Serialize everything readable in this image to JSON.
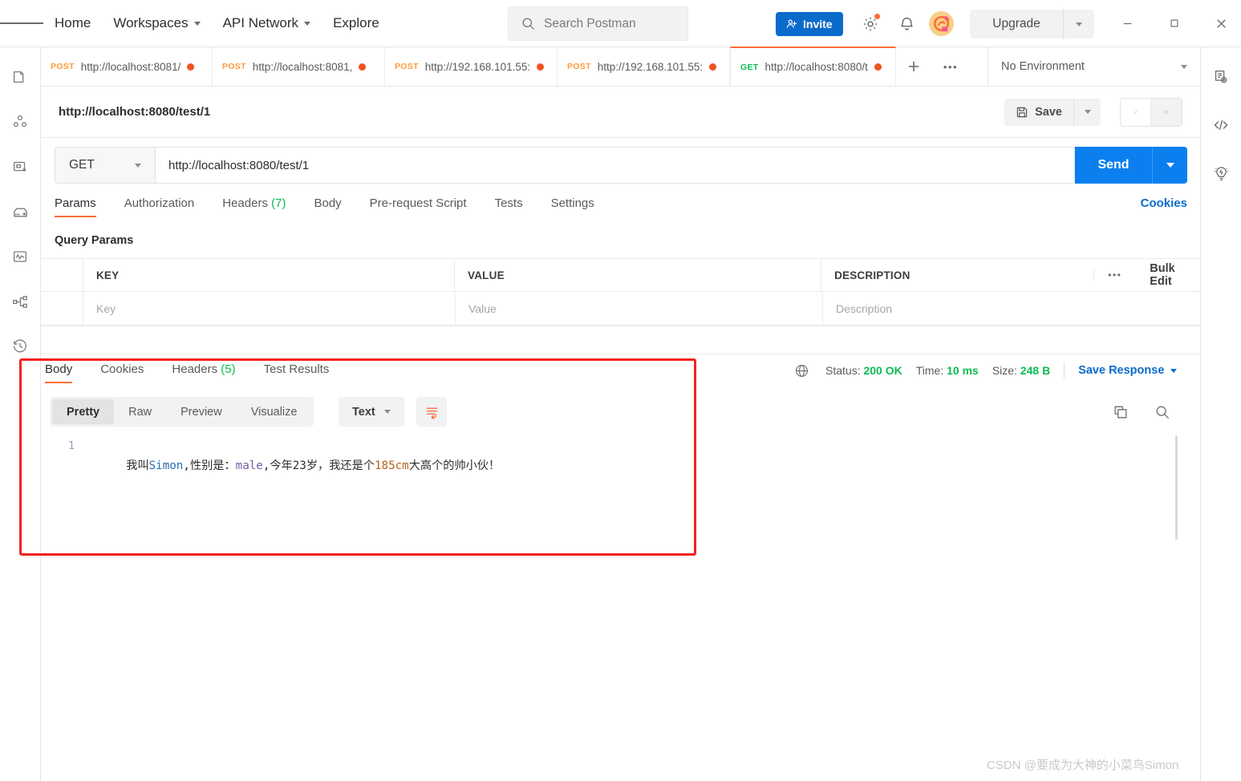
{
  "header": {
    "menu_icon": "hamburger-icon",
    "nav": [
      {
        "label": "Home",
        "has_caret": false
      },
      {
        "label": "Workspaces",
        "has_caret": true
      },
      {
        "label": "API Network",
        "has_caret": true
      },
      {
        "label": "Explore",
        "has_caret": false
      }
    ],
    "search_placeholder": "Search Postman",
    "invite_label": "Invite",
    "upgrade_label": "Upgrade",
    "icons": [
      "search-icon",
      "settings-gear-icon",
      "notifications-bell-icon",
      "user-avatar",
      "minimize-icon",
      "maximize-icon",
      "close-icon"
    ]
  },
  "left_rail": [
    {
      "name": "collections-icon"
    },
    {
      "name": "apis-icon"
    },
    {
      "name": "environments-icon"
    },
    {
      "name": "mock-servers-icon"
    },
    {
      "name": "monitors-icon"
    },
    {
      "name": "flows-icon"
    },
    {
      "name": "history-icon"
    }
  ],
  "right_rail": [
    {
      "name": "environment-quick-look-icon"
    },
    {
      "name": "code-snippet-icon"
    },
    {
      "name": "lightbulb-icon"
    }
  ],
  "tabs": [
    {
      "method": "POST",
      "url": "http://localhost:8081/",
      "unsaved": true,
      "active": false
    },
    {
      "method": "POST",
      "url": "http://localhost:8081,",
      "unsaved": true,
      "active": false
    },
    {
      "method": "POST",
      "url": "http://192.168.101.55:",
      "unsaved": true,
      "active": false
    },
    {
      "method": "POST",
      "url": "http://192.168.101.55:",
      "unsaved": true,
      "active": false
    },
    {
      "method": "GET",
      "url": "http://localhost:8080/t",
      "unsaved": true,
      "active": true
    }
  ],
  "tab_add_label": "+",
  "tab_more_label": "•••",
  "environment": {
    "selected": "No Environment"
  },
  "request": {
    "title": "http://localhost:8080/test/1",
    "save_label": "Save",
    "method": "GET",
    "url": "http://localhost:8080/test/1",
    "send_label": "Send",
    "tabs": [
      {
        "label": "Params",
        "count": "",
        "active": true
      },
      {
        "label": "Authorization",
        "count": "",
        "active": false
      },
      {
        "label": "Headers",
        "count": "(7)",
        "active": false
      },
      {
        "label": "Body",
        "count": "",
        "active": false
      },
      {
        "label": "Pre-request Script",
        "count": "",
        "active": false
      },
      {
        "label": "Tests",
        "count": "",
        "active": false
      },
      {
        "label": "Settings",
        "count": "",
        "active": false
      }
    ],
    "cookies_link": "Cookies",
    "query_params_label": "Query Params",
    "table": {
      "headers": [
        "KEY",
        "VALUE",
        "DESCRIPTION"
      ],
      "more_label": "•••",
      "bulk_edit_label": "Bulk Edit",
      "placeholder_row": [
        "Key",
        "Value",
        "Description"
      ]
    }
  },
  "response": {
    "tabs": [
      {
        "label": "Body",
        "count": "",
        "active": true
      },
      {
        "label": "Cookies",
        "count": "",
        "active": false
      },
      {
        "label": "Headers",
        "count": "(5)",
        "active": false
      },
      {
        "label": "Test Results",
        "count": "",
        "active": false
      }
    ],
    "view_modes": [
      {
        "label": "Pretty",
        "active": true
      },
      {
        "label": "Raw",
        "active": false
      },
      {
        "label": "Preview",
        "active": false
      },
      {
        "label": "Visualize",
        "active": false
      }
    ],
    "format": "Text",
    "wrap_icon": "word-wrap-icon",
    "line_number": "1",
    "body_segments": [
      {
        "text": "我叫",
        "color": "plain"
      },
      {
        "text": "Simon",
        "color": "blue"
      },
      {
        "text": ",性别是：",
        "color": "plain"
      },
      {
        "text": "male",
        "color": "purple"
      },
      {
        "text": ",今年",
        "color": "plain"
      },
      {
        "text": "23",
        "color": "plain"
      },
      {
        "text": "岁，我还是个",
        "color": "plain"
      },
      {
        "text": "185cm",
        "color": "num"
      },
      {
        "text": "大高个的帅小伙！",
        "color": "plain"
      }
    ],
    "body_text": "我叫Simon,性别是：male,今年23岁，我还是个185cm大高个的帅小伙！",
    "status_label": "Status:",
    "status_value": "200 OK",
    "time_label": "Time:",
    "time_value": "10 ms",
    "size_label": "Size:",
    "size_value": "248 B",
    "save_response_label": "Save Response",
    "tools": [
      "copy-icon",
      "search-icon"
    ]
  },
  "annotation": {
    "highlight_color": "#f42020"
  },
  "watermark": "CSDN @要成为大神的小菜鸟Simon"
}
